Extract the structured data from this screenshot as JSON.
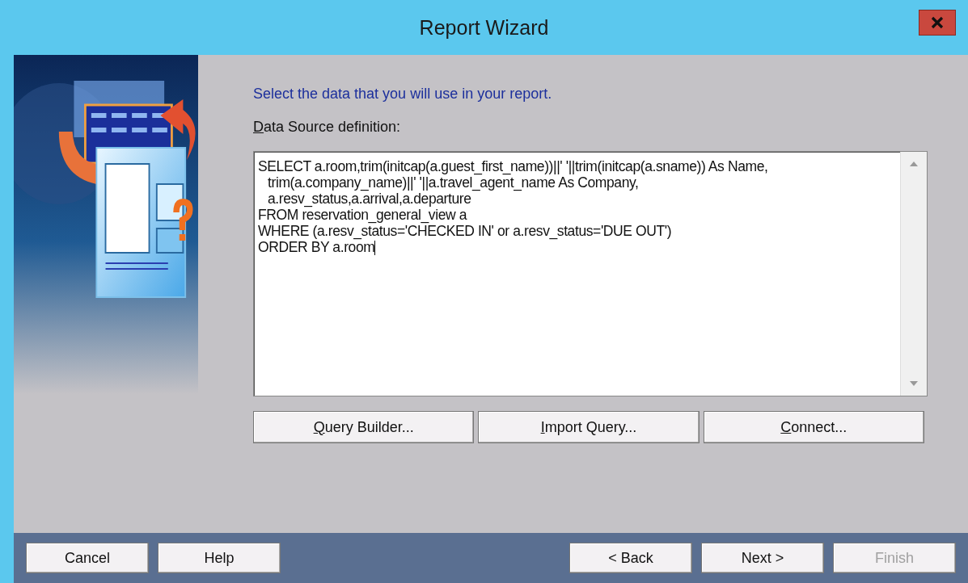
{
  "window": {
    "title": "Report Wizard"
  },
  "instruction": "Select the data that you will use in your report.",
  "definition_label": {
    "label": "Data Source definition:"
  },
  "query_editor": {
    "lines": [
      {
        "text": "SELECT a.room,trim(initcap(a.guest_first_name))||' '||trim(initcap(a.sname)) As Name,",
        "indented": false
      },
      {
        "text": "trim(a.company_name)||' '||a.travel_agent_name As Company,",
        "indented": true
      },
      {
        "text": "a.resv_status,a.arrival,a.departure",
        "indented": true
      },
      {
        "text": "FROM reservation_general_view a",
        "indented": false
      },
      {
        "text": "WHERE (a.resv_status='CHECKED IN' or a.resv_status='DUE OUT')",
        "indented": false
      },
      {
        "text": "ORDER BY a.room",
        "indented": false
      }
    ]
  },
  "query_buttons": [
    {
      "label": "Query Builder..."
    },
    {
      "label": "Import Query..."
    },
    {
      "label": "Connect..."
    }
  ],
  "footer_left": [
    {
      "label": "Cancel",
      "disabled": false
    },
    {
      "label": "Help",
      "disabled": false
    }
  ],
  "footer_right": [
    {
      "label": "< Back",
      "disabled": false
    },
    {
      "label": "Next >",
      "disabled": false
    },
    {
      "label": "Finish",
      "disabled": true
    }
  ]
}
